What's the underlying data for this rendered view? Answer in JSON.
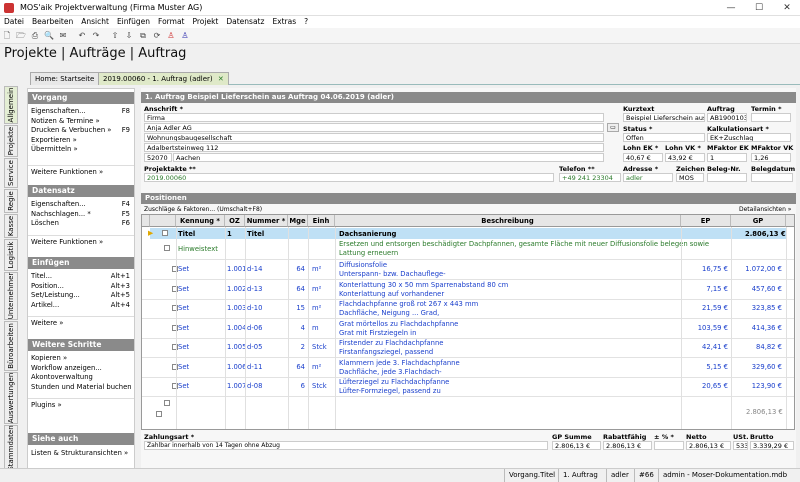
{
  "window": {
    "title": "MOS'aik Projektverwaltung (Firma Muster AG)",
    "minimize": "—",
    "maximize": "☐",
    "close": "✕"
  },
  "menu": [
    "Datei",
    "Bearbeiten",
    "Ansicht",
    "Einfügen",
    "Format",
    "Projekt",
    "Datensatz",
    "Extras",
    "?"
  ],
  "toolbar_icons": [
    "new-icon",
    "open-icon",
    "print-icon",
    "preview-icon",
    "mail-icon",
    "undo-icon",
    "redo-icon",
    "up-icon",
    "down-icon",
    "copy-icon",
    "refresh-icon",
    "user-icon",
    "user2-icon"
  ],
  "toolbar_glyphs": [
    "🗋",
    "🗁",
    "⎙",
    "🔍",
    "✉",
    "↶",
    "↷",
    "⇧",
    "⇩",
    "⧉",
    "⟳",
    "♙",
    "♙"
  ],
  "app_title": "Projekte | Aufträge | Auftrag",
  "tabs": {
    "home": "Home: Startseite",
    "doc": "2019.00060 - 1. Auftrag (adler)",
    "close": "✕"
  },
  "vtabs": [
    "Allgemein",
    "Projekte",
    "Service",
    "Regie",
    "Kasse",
    "Logistik",
    "Unternehmer",
    "Büroarbeiten",
    "Auswertungen",
    "Stammdaten"
  ],
  "left": {
    "vorgang": {
      "title": "Vorgang",
      "items": [
        {
          "l": "Eigenschaften...",
          "k": "F8"
        },
        {
          "l": "Notizen & Termine »",
          "k": ""
        },
        {
          "l": "Drucken & Verbuchen »",
          "k": "F9"
        },
        {
          "l": "Exportieren »",
          "k": ""
        },
        {
          "l": "Übermitteln »",
          "k": ""
        }
      ],
      "more": "Weitere Funktionen »"
    },
    "datensatz": {
      "title": "Datensatz",
      "items": [
        {
          "l": "Eigenschaften...",
          "k": "F4"
        },
        {
          "l": "Nachschlagen... *",
          "k": "F5"
        },
        {
          "l": "Löschen",
          "k": "F6"
        }
      ],
      "more": "Weitere Funktionen »"
    },
    "einfuegen": {
      "title": "Einfügen",
      "items": [
        {
          "l": "Titel...",
          "k": "Alt+1"
        },
        {
          "l": "Position...",
          "k": "Alt+3"
        },
        {
          "l": "Set/Leistung...",
          "k": "Alt+5"
        },
        {
          "l": "Artikel...",
          "k": "Alt+4"
        }
      ],
      "more": "Weitere »"
    },
    "schritte": {
      "title": "Weitere Schritte",
      "items": [
        {
          "l": "Kopieren »",
          "k": ""
        },
        {
          "l": "Workflow anzeigen...",
          "k": ""
        },
        {
          "l": "Akontoverwaltung",
          "k": ""
        },
        {
          "l": "Stunden und Material buchen",
          "k": ""
        }
      ],
      "more": "Plugins »"
    },
    "auch": {
      "title": "Siehe auch",
      "items": [
        {
          "l": "Listen & Strukturansichten »",
          "k": ""
        }
      ]
    }
  },
  "header": {
    "title": "1. Auftrag Beispiel Lieferschein aus Auftrag 04.06.2019 (adler)",
    "anschrift_label": "Anschrift *",
    "anschrift": [
      "Firma",
      "Anja Adler AG",
      "Wohnungsbaugesellschaft",
      "Adalbertsteinweg 112"
    ],
    "plz": "52070",
    "ort": "Aachen",
    "kurztext_label": "Kurztext",
    "kurztext": "Beispiel Lieferschein aus Au",
    "auftrag_label": "Auftrag",
    "auftrag": "AB1900103",
    "termin_label": "Termin *",
    "termin": "",
    "status_label": "Status *",
    "status": "Offen",
    "kalk_label": "Kalkulationsart *",
    "kalk": "EK+Zuschlag",
    "lohnek_label": "Lohn EK *",
    "lohnek": "40,67 €",
    "lohnvk_label": "Lohn VK *",
    "lohnvk": "43,92 €",
    "mfek_label": "MFaktor EK",
    "mfek": "1",
    "mfvk_label": "MFaktor VK",
    "mfvk": "1,26",
    "projektakte_label": "Projektakte **",
    "projektakte": "2019.00060",
    "telefon_label": "Telefon **",
    "telefon": "+49 241 23304",
    "adresse_label": "Adresse *",
    "adresse": "adler",
    "zeichen_label": "Zeichen",
    "zeichen": "MOS",
    "belegnr_label": "Beleg-Nr.",
    "belegnr": "",
    "belegdatum_label": "Belegdatum",
    "belegdatum": ""
  },
  "positionen": {
    "title": "Positionen",
    "zuschlaege": "Zuschläge & Faktoren... (Umschalt+F8)",
    "detail": "Detailansichten »"
  },
  "grid": {
    "headers": [
      "Kennung *",
      "OZ",
      "Nummer *",
      "Mge",
      "Einh",
      "Beschreibung",
      "EP",
      "GP"
    ],
    "title_row": {
      "kennung": "Titel",
      "oz": "1",
      "nummer": "Titel",
      "desc": "Dachsanierung",
      "gp": "2.806,13 €"
    },
    "hint_row": {
      "kennung": "Hinweistext",
      "desc1": "Ersetzen und entsorgen beschädigter Dachpfannen, gesamte Fläche mit neuer Diffusionsfolie belegen sowie",
      "desc2": "Lattung erneuern"
    },
    "rows": [
      {
        "kennung": "Set",
        "oz": "1.001",
        "nummer": "d-14",
        "mge": "64",
        "einh": "m²",
        "d1": "Diffusionsfolie",
        "d2": "Unterspann- bzw. Dachauflege-",
        "ep": "16,75 €",
        "gp": "1.072,00 €"
      },
      {
        "kennung": "Set",
        "oz": "1.002",
        "nummer": "d-13",
        "mge": "64",
        "einh": "m²",
        "d1": "Konterlattung 30 x 50 mm Sparrenabstand 80 cm",
        "d2": "Konterlattung auf vorhandener",
        "ep": "7,15 €",
        "gp": "457,60 €"
      },
      {
        "kennung": "Set",
        "oz": "1.003",
        "nummer": "d-10",
        "mge": "15",
        "einh": "m²",
        "d1": "Flachdachpfanne groß rot 267 x 443 mm",
        "d2": "Dachfläche, Neigung ... Grad,",
        "ep": "21,59 €",
        "gp": "323,85 €"
      },
      {
        "kennung": "Set",
        "oz": "1.004",
        "nummer": "d-06",
        "mge": "4",
        "einh": "m",
        "d1": "Grat mörtellos zu Flachdachpfanne",
        "d2": "Grat mit Firstziegeln in",
        "ep": "103,59 €",
        "gp": "414,36 €"
      },
      {
        "kennung": "Set",
        "oz": "1.005",
        "nummer": "d-05",
        "mge": "2",
        "einh": "Stck",
        "d1": "Firstender zu Flachdachpfanne",
        "d2": "Firstanfangsziegel, passend",
        "ep": "42,41 €",
        "gp": "84,82 €"
      },
      {
        "kennung": "Set",
        "oz": "1.006",
        "nummer": "d-11",
        "mge": "64",
        "einh": "m²",
        "d1": "Klammern jede 3. Flachdachpfanne",
        "d2": "Dachfläche, jede 3.Flachdach-",
        "ep": "5,15 €",
        "gp": "329,60 €"
      },
      {
        "kennung": "Set",
        "oz": "1.007",
        "nummer": "d-08",
        "mge": "6",
        "einh": "Stck",
        "d1": "Lüfterziegel zu Flachdachpfanne",
        "d2": "Lüfter-Formziegel, passend zu",
        "ep": "20,65 €",
        "gp": "123,90 €"
      }
    ],
    "subtotal": "2.806,13 €"
  },
  "footer": {
    "zahlungsart_label": "Zahlungsart *",
    "zahlungsart": "Zahlbar innerhalb von 14 Tagen ohne Abzug",
    "gpsumme_label": "GP Summe",
    "gpsumme": "2.806,13 €",
    "rabatt_label": "Rabattfähig",
    "rabatt": "2.806,13 €",
    "pct_label": "± % *",
    "pct": "",
    "netto_label": "Netto",
    "netto": "2.806,13 €",
    "ust_label": "USt.",
    "ust": "533,16 €",
    "brutto_label": "Brutto",
    "brutto": "3.339,29 €"
  },
  "status": {
    "field": "Vorgang.Titel",
    "doc": "1. Auftrag",
    "user": "adler",
    "num": "#66",
    "db": "admin - Moser-Dokumentation.mdb"
  },
  "colors": {
    "title_row": "#bfe0f5",
    "accent_green": "#2a7a2a",
    "link_blue": "#1a3fcc",
    "header_gray": "#8a8a8a"
  }
}
